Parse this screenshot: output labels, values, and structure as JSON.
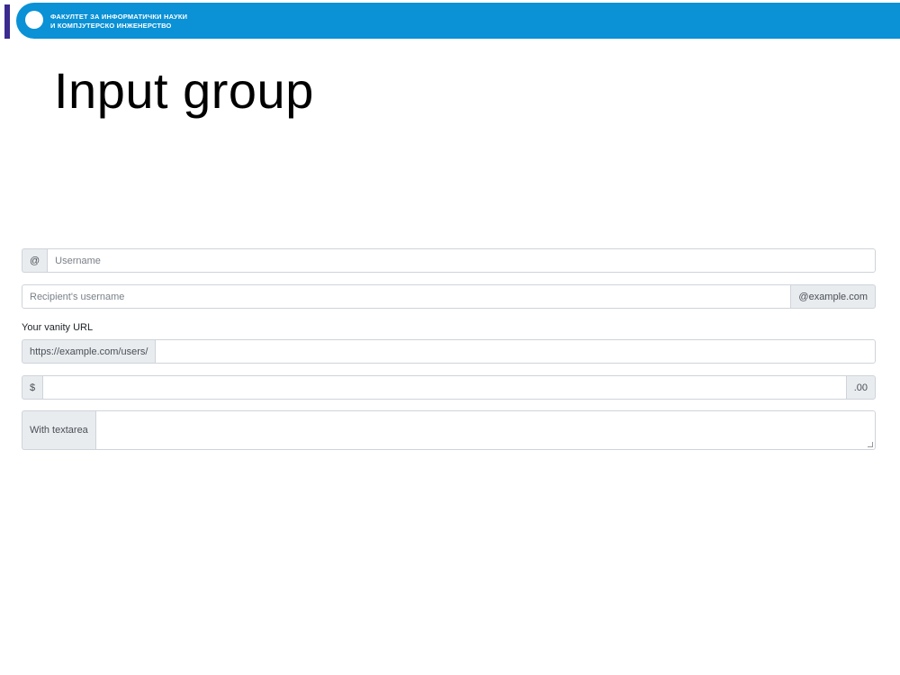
{
  "header": {
    "faculty_line1": "ФАКУЛТЕТ ЗА ИНФОРМАТИЧКИ НАУКИ",
    "faculty_line2": "И КОМПЈУТЕРСКО ИНЖЕНЕРСТВО",
    "brand_color": "#0a91d6",
    "accent_color": "#3b2a8f"
  },
  "title": "Input group",
  "groups": {
    "username": {
      "prefix": "@",
      "placeholder": "Username"
    },
    "recipient": {
      "placeholder": "Recipient's username",
      "suffix": "@example.com"
    },
    "vanity": {
      "label": "Your vanity URL",
      "prefix": "https://example.com/users/",
      "value": ""
    },
    "amount": {
      "prefix": "$",
      "suffix": ".00",
      "value": ""
    },
    "textarea": {
      "prefix": "With textarea",
      "value": ""
    }
  }
}
